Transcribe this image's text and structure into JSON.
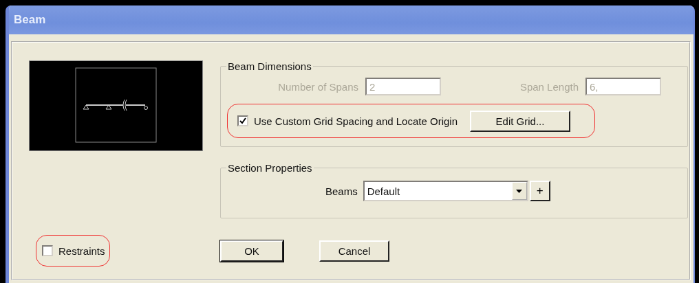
{
  "window": {
    "title": "Beam"
  },
  "beam_dimensions": {
    "title": "Beam Dimensions",
    "fields": [
      {
        "label": "Number of Spans",
        "value": "2",
        "disabled": true
      },
      {
        "label": "Span Length",
        "value": "6,",
        "disabled": true
      }
    ],
    "custom_grid": {
      "label": "Use Custom Grid Spacing and Locate Origin",
      "checked": true
    },
    "edit_button": "Edit Grid..."
  },
  "section_properties": {
    "title": "Section Properties",
    "label": "Beams",
    "value": "Default",
    "add_button": "+"
  },
  "buttons": [
    {
      "label": "OK",
      "default": true
    },
    {
      "label": "Cancel",
      "default": false
    }
  ],
  "restraints": {
    "label": "Restraints",
    "checked": false
  }
}
